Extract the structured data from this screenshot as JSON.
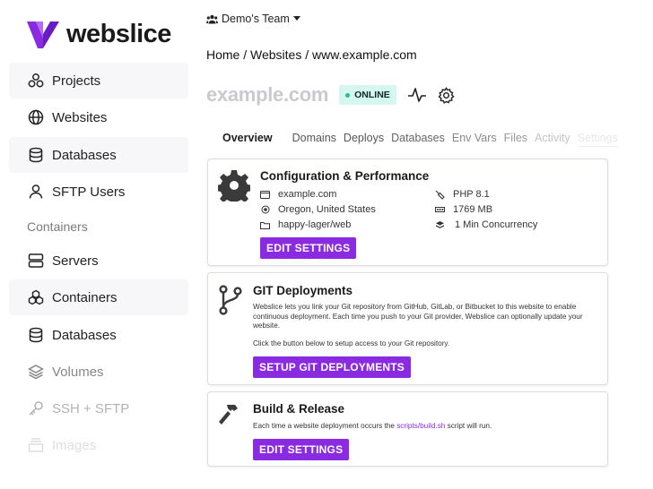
{
  "brand": {
    "name": "webslice",
    "accent": "#8a2be2"
  },
  "sidebar": {
    "items": [
      {
        "label": "Projects",
        "icon": "projects-icon"
      },
      {
        "label": "Websites",
        "icon": "globe-icon"
      },
      {
        "label": "Databases",
        "icon": "database-icon"
      },
      {
        "label": "SFTP Users",
        "icon": "user-icon"
      }
    ],
    "section_heading": "Containers",
    "container_items": [
      {
        "label": "Servers",
        "icon": "server-icon"
      },
      {
        "label": "Containers",
        "icon": "containers-icon"
      },
      {
        "label": "Databases",
        "icon": "database-icon"
      },
      {
        "label": "Volumes",
        "icon": "layers-icon"
      },
      {
        "label": "SSH + SFTP",
        "icon": "key-icon"
      },
      {
        "label": "Images",
        "icon": "images-icon"
      }
    ]
  },
  "header": {
    "team": "Demo's Team",
    "breadcrumb": "Home / Websites / www.example.com",
    "site_title": "example.com",
    "status": "ONLINE"
  },
  "tabs": [
    "Overview",
    "Domains",
    "Deploys",
    "Databases",
    "Env Vars",
    "Files",
    "Activity",
    "Settings"
  ],
  "config": {
    "title": "Configuration & Performance",
    "domain": "example.com",
    "region": "Oregon, United States",
    "path": "happy-lager/web",
    "php": "PHP 8.1",
    "memory": "1769 MB",
    "concurrency": "1 Min Concurrency",
    "button": "EDIT SETTINGS"
  },
  "git": {
    "title": "GIT Deployments",
    "description": "Webslice lets you link your Git repository from GitHub, GitLab, or Bitbucket to this website to enable continuous deployment. Each time you push to your Git provider, Webslice can optionally update your website.",
    "hint": "Click the button below to setup access to your Git repository.",
    "button": "SETUP GIT DEPLOYMENTS"
  },
  "build": {
    "title": "Build & Release",
    "text_before": "Each time a website deployment occurs the ",
    "script": "scripts/build.sh",
    "text_after": " script will run.",
    "button": "EDIT SETTINGS"
  }
}
